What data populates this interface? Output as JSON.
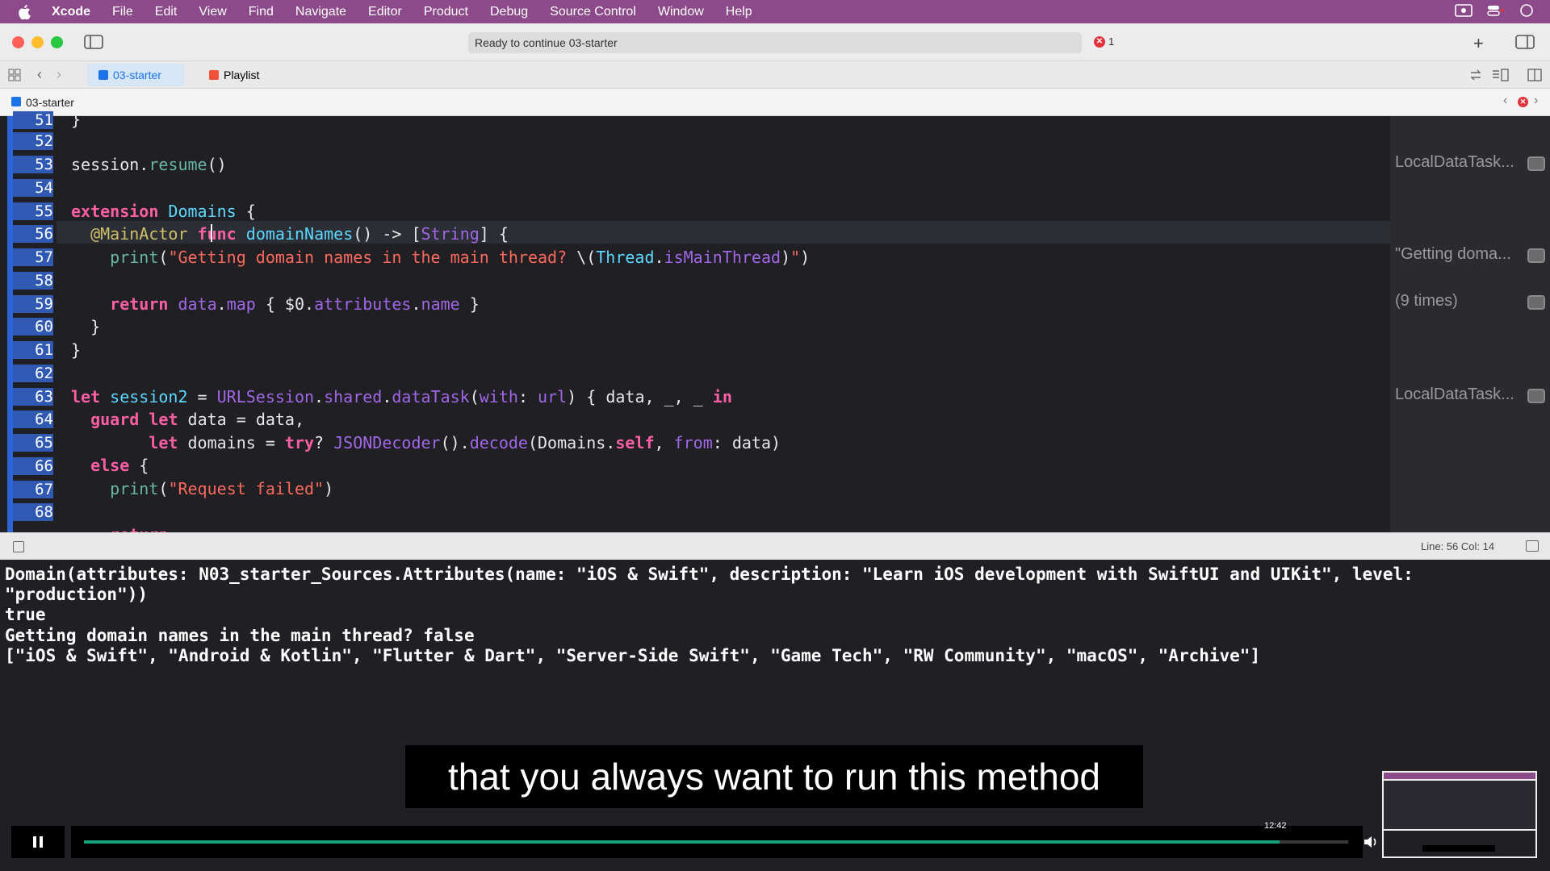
{
  "menubar": {
    "app": "Xcode",
    "items": [
      "File",
      "Edit",
      "View",
      "Find",
      "Navigate",
      "Editor",
      "Product",
      "Debug",
      "Source Control",
      "Window",
      "Help"
    ]
  },
  "toolbar": {
    "status": "Ready to continue 03-starter",
    "error_count": "1"
  },
  "tabs": [
    {
      "label": "03-starter",
      "active": true
    },
    {
      "label": "Playlist",
      "active": false
    }
  ],
  "breadcrumb": "03-starter",
  "editor": {
    "line_numbers": [
      "51",
      "52",
      "53",
      "54",
      "55",
      "56",
      "57",
      "58",
      "59",
      "60",
      "61",
      "62",
      "63",
      "64",
      "65",
      "66",
      "67",
      "68"
    ],
    "current_line": "56"
  },
  "results": [
    {
      "line": "53",
      "text": "LocalDataTask..."
    },
    {
      "line": "57",
      "text": "\"Getting doma..."
    },
    {
      "line": "59",
      "text": "(9 times)"
    },
    {
      "line": "63",
      "text": "LocalDataTask..."
    }
  ],
  "debugbar": {
    "cursor": "Line: 56  Col: 14"
  },
  "console": [
    "Domain(attributes: N03_starter_Sources.Attributes(name: \"iOS & Swift\", description: \"Learn iOS development with SwiftUI and UIKit\", level:",
    "\"production\"))",
    "true",
    "Getting domain names in the main thread? false",
    "[\"iOS & Swift\", \"Android & Kotlin\", \"Flutter & Dart\", \"Server-Side Swift\", \"Game Tech\", \"RW Community\", \"macOS\", \"Archive\"]"
  ],
  "video": {
    "subtitle": "that you always want to run this method",
    "time": "12:42",
    "progress": 0.946
  },
  "colors": {
    "menubar": "#8d4a8b",
    "keyword": "#fc5fa3",
    "type": "#5dd8ff",
    "string": "#fc6a5d",
    "progress": "#16a37a"
  },
  "icons": [
    "apple-icon",
    "sidebar-toggle-icon",
    "add-icon",
    "inspector-toggle-icon",
    "grid-icon",
    "back-icon",
    "forward-icon",
    "pause-icon",
    "volume-icon"
  ]
}
